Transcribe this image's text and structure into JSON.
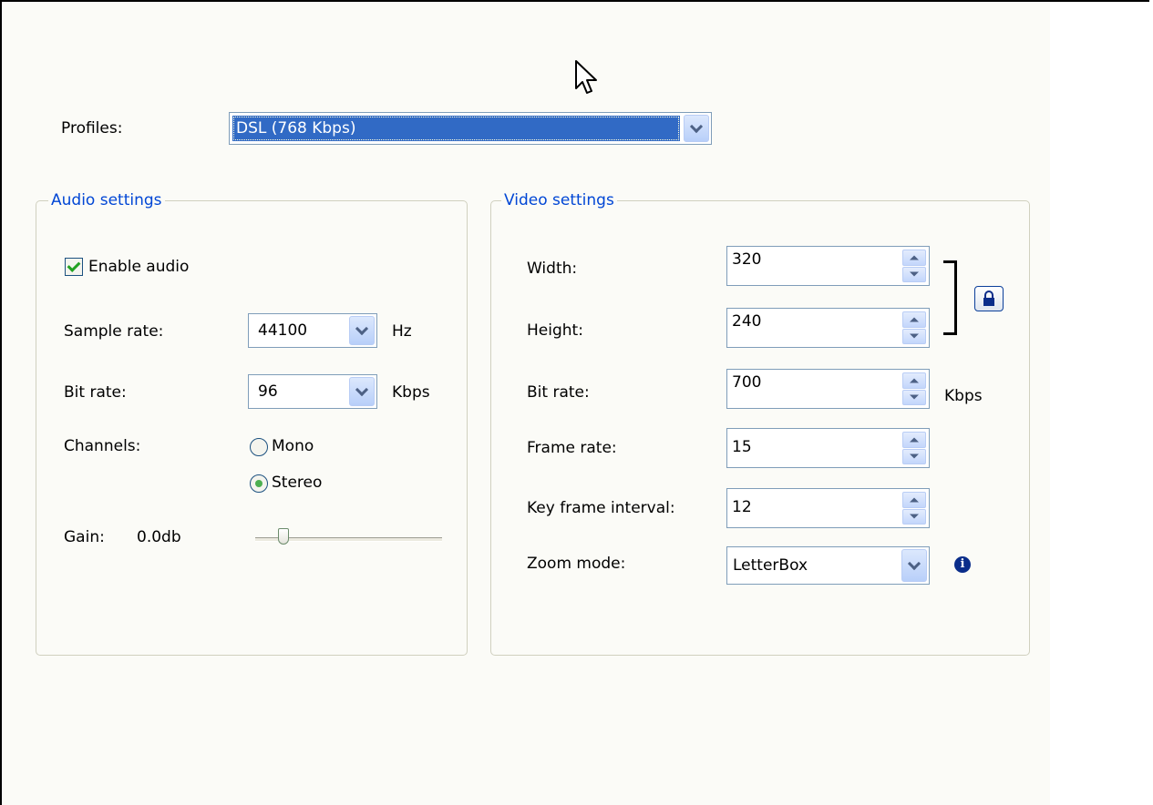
{
  "profiles": {
    "label": "Profiles:",
    "value": "DSL (768 Kbps)"
  },
  "audio": {
    "title": "Audio settings",
    "enable_audio": {
      "label": "Enable audio",
      "checked": true
    },
    "sample_rate": {
      "label": "Sample rate:",
      "value": "44100",
      "unit": "Hz"
    },
    "bit_rate": {
      "label": "Bit rate:",
      "value": "96",
      "unit": "Kbps"
    },
    "channels": {
      "label": "Channels:",
      "options": [
        {
          "label": "Mono",
          "selected": false
        },
        {
          "label": "Stereo",
          "selected": true
        }
      ]
    },
    "gain": {
      "label": "Gain:",
      "value": "0.0db"
    }
  },
  "video": {
    "title": "Video settings",
    "width": {
      "label": "Width:",
      "value": "320"
    },
    "height": {
      "label": "Height:",
      "value": "240"
    },
    "bit_rate": {
      "label": "Bit rate:",
      "value": "700",
      "unit": "Kbps"
    },
    "frame_rate": {
      "label": "Frame rate:",
      "value": "15"
    },
    "key_frame_interval": {
      "label": "Key frame interval:",
      "value": "12"
    },
    "zoom_mode": {
      "label": "Zoom mode:",
      "value": "LetterBox"
    }
  },
  "icons": {
    "lock": "lock-icon",
    "info": "info-icon",
    "cursor": "mouse-pointer"
  },
  "colors": {
    "selection": "#316ac5",
    "group_title": "#0046d5",
    "panel_bg": "#fbfbf7"
  }
}
